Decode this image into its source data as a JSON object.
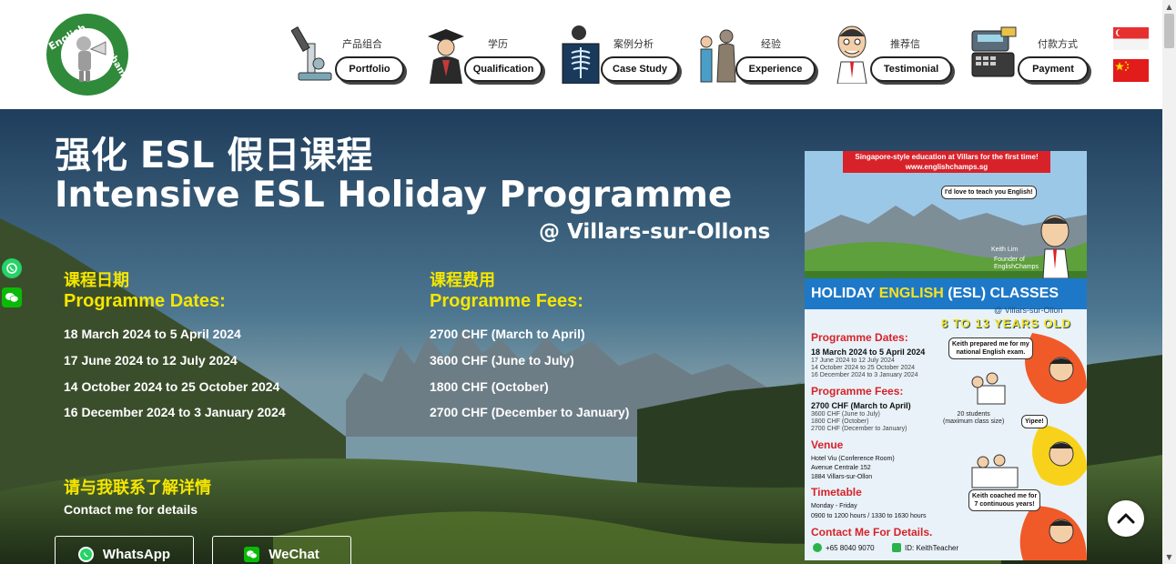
{
  "nav": {
    "items": [
      {
        "cn": "产品组合",
        "en": "Portfolio",
        "icon": "microscope-icon"
      },
      {
        "cn": "学历",
        "en": "Qualification",
        "icon": "graduate-icon"
      },
      {
        "cn": "案例分析",
        "en": "Case Study",
        "icon": "xray-icon"
      },
      {
        "cn": "经验",
        "en": "Experience",
        "icon": "sculpture-icon"
      },
      {
        "cn": "推荐信",
        "en": "Testimonial",
        "icon": "teacher-icon"
      },
      {
        "cn": "付款方式",
        "en": "Payment",
        "icon": "cash-register-icon"
      }
    ]
  },
  "hero": {
    "title_cn": "强化 ESL 假日课程",
    "title_en": "Intensive ESL Holiday Programme",
    "location": "@ Villars-sur-Ollons",
    "dates": {
      "heading_cn": "课程日期",
      "heading_en": "Programme Dates:",
      "lines": [
        "18 March 2024 to 5 April 2024",
        "17 June 2024 to 12 July 2024",
        "14 October 2024 to 25 October 2024",
        "16 December 2024 to 3 January 2024"
      ]
    },
    "fees": {
      "heading_cn": "课程费用",
      "heading_en": "Programme Fees:",
      "lines": [
        "2700 CHF (March to April)",
        "3600 CHF (June to July)",
        "1800 CHF (October)",
        "2700 CHF (December to January)"
      ]
    },
    "contact_cn": "请与我联系了解详情",
    "contact_en": "Contact me for details",
    "whatsapp_label": "WhatsApp",
    "wechat_label": "WeChat"
  },
  "poster": {
    "banner_line1": "Singapore-style education at Villars for the first time!",
    "banner_line2": "www.englishchamps.sg",
    "bubble_top": "I'd love to teach you English!",
    "founder_name": "Keith Lim",
    "founder_title": "Founder of",
    "founder_company": "EnglishChamps",
    "heading_a": "HOLIDAY ",
    "heading_b": "ENGLISH",
    "heading_c": " (ESL) CLASSES",
    "location": "@ Villars-sur-Ollon",
    "age": "8 TO 13 YEARS OLD",
    "dates_title": "Programme Dates:",
    "date_main": "18 March 2024 to 5 April 2024",
    "date_2": "17 June 2024 to 12 July 2024",
    "date_3": "14 October 2024 to 25 October 2024",
    "date_4": "16 December 2024 to 3 January 2024",
    "fees_title": "Programme Fees:",
    "fee_main": "2700 CHF (March to April)",
    "fee_2": "3600 CHF (June to July)",
    "fee_3": "1800 CHF (October)",
    "fee_4": "2700 CHF (December to January)",
    "venue_title": "Venue",
    "venue_1": "Hotel Viu (Conference Room)",
    "venue_2": "Avenue Centrale 152",
    "venue_3": "1884 Villars-sur-Ollon",
    "timetable_title": "Timetable",
    "time_1": "Monday - Friday",
    "time_2": "0900 to 1200 hours / 1330 to 1630 hours",
    "contact_title": "Contact Me For Details.",
    "bubble_exam_1": "Keith prepared me for my",
    "bubble_exam_2": "national English exam.",
    "students_1": "20 students",
    "students_2": "(maximum class size)",
    "bubble_yipee": "Yipee!",
    "bubble_coached_1": "Keith coached me for",
    "bubble_coached_2": "7 continuous years!",
    "phone": "+65 8040 9070",
    "wechat_id": "ID: KeithTeacher"
  },
  "colors": {
    "accent_yellow": "#f5e600",
    "poster_red": "#d8222a",
    "poster_blue": "#1e78c8",
    "whatsapp_green": "#25d366"
  }
}
